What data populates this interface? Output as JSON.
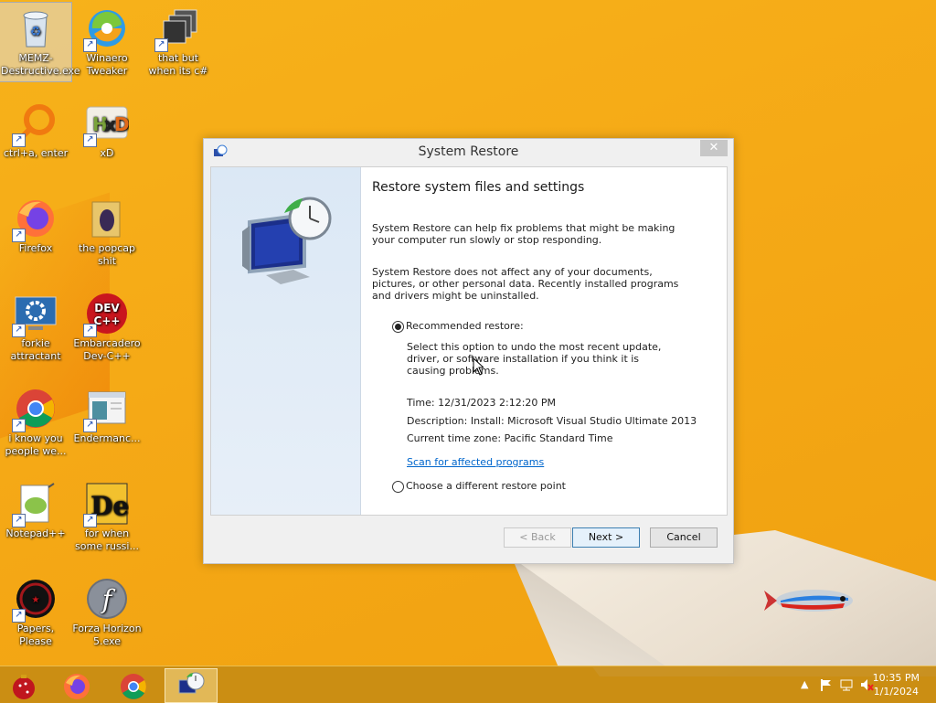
{
  "desktop": {
    "icons": [
      {
        "label": "MEMZ-Destructive.exe",
        "icon": "recycle-bin-icon"
      },
      {
        "label": "Winaero Tweaker",
        "icon": "winaero-icon"
      },
      {
        "label": "that but when its c#",
        "icon": "stack-icon"
      },
      {
        "label": "ctrl+a, enter",
        "icon": "magnifier-ring-icon"
      },
      {
        "label": "xD",
        "icon": "hxd-icon"
      },
      {
        "label": "Firefox",
        "icon": "firefox-icon"
      },
      {
        "label": "the popcap shit",
        "icon": "folder-icon"
      },
      {
        "label": "forkie attractant",
        "icon": "gear-monitor-icon"
      },
      {
        "label": "Embarcadero Dev-C++",
        "icon": "devcpp-icon"
      },
      {
        "label": "i know you people we...",
        "icon": "chrome-icon"
      },
      {
        "label": "Endermanc...",
        "icon": "window-icon"
      },
      {
        "label": "Notepad++",
        "icon": "notepadpp-icon"
      },
      {
        "label": "for when some russi...",
        "icon": "de-icon"
      },
      {
        "label": "Papers, Please",
        "icon": "papers-please-icon"
      },
      {
        "label": "Forza Horizon 5.exe",
        "icon": "flash-icon"
      }
    ]
  },
  "dialog": {
    "title": "System Restore",
    "close_glyph": "✕",
    "heading": "Restore system files and settings",
    "para1": "System Restore can help fix problems that might be making your computer run slowly or stop responding.",
    "para2": "System Restore does not affect any of your documents, pictures, or other personal data. Recently installed programs and drivers might be uninstalled.",
    "recommended_label": "Recommended restore:",
    "recommended_desc": "Select this option to undo the most recent update, driver, or software installation if you think it is causing problems.",
    "time": "Time: 12/31/2023 2:12:20 PM",
    "description": "Description: Install: Microsoft Visual Studio Ultimate 2013",
    "timezone": "Current time zone: Pacific Standard Time",
    "scan_link": "Scan for affected programs",
    "different_label": "Choose a different restore point",
    "selected_option": "recommended",
    "buttons": {
      "back": "< Back",
      "next": "Next >",
      "cancel": "Cancel"
    }
  },
  "taskbar": {
    "items": [
      {
        "name": "memz-app",
        "icon": "ornament-icon",
        "active": false
      },
      {
        "name": "firefox",
        "icon": "firefox-icon",
        "active": false
      },
      {
        "name": "chrome",
        "icon": "chrome-icon",
        "active": false
      },
      {
        "name": "system-restore",
        "icon": "system-restore-icon",
        "active": true
      }
    ],
    "clock_time": "10:35 PM",
    "clock_date": "1/1/2024"
  },
  "colors": {
    "accent": "#f5a916",
    "link": "#0066cc",
    "taskbar": "#c88c14"
  }
}
